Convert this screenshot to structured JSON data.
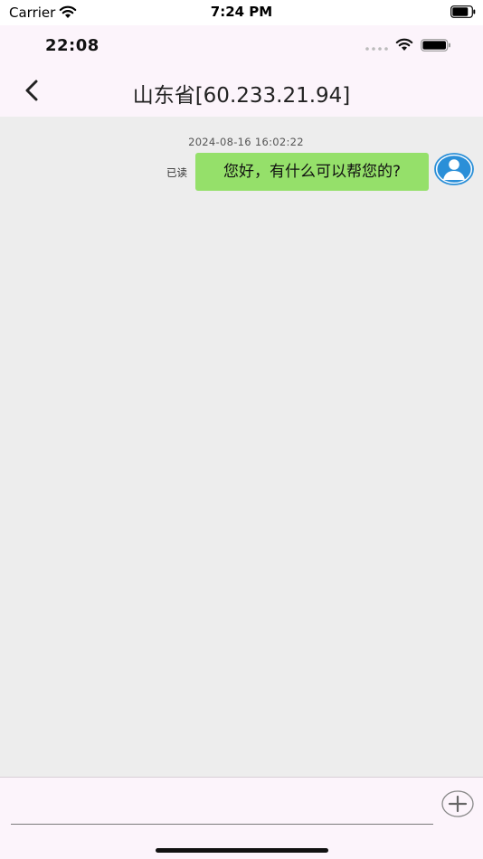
{
  "device_status": {
    "carrier": "Carrier",
    "time": "7:24 PM"
  },
  "app_status": {
    "time": "22:08"
  },
  "nav": {
    "title": "山东省[60.233.21.94]"
  },
  "chat": {
    "messages": [
      {
        "timestamp": "2024-08-16 16:02:22",
        "read_status": "已读",
        "text": "您好，有什么可以帮您的?"
      }
    ]
  },
  "input": {
    "value": "",
    "placeholder": ""
  },
  "icons": {
    "back": "chevron-left-icon",
    "avatar": "user-avatar-icon",
    "add": "plus-circle-icon",
    "wifi": "wifi-icon",
    "battery": "battery-icon"
  },
  "colors": {
    "header_bg": "#fcf4fb",
    "chat_bg": "#ededed",
    "bubble_bg": "#95e06a",
    "avatar_blue": "#2a8fd8"
  }
}
